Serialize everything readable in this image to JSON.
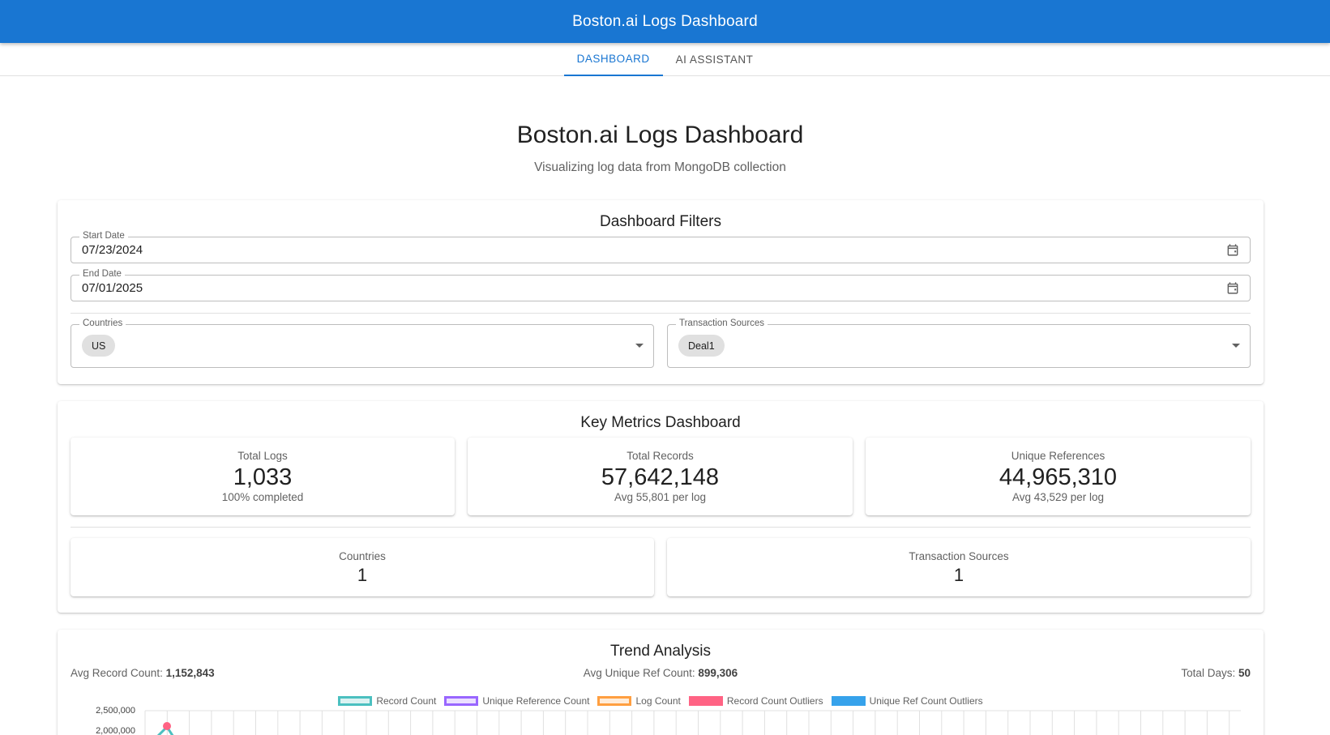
{
  "appbar": {
    "title": "Boston.ai Logs Dashboard"
  },
  "tabs": [
    {
      "label": "DASHBOARD",
      "active": true
    },
    {
      "label": "AI ASSISTANT",
      "active": false
    }
  ],
  "header": {
    "title": "Boston.ai Logs Dashboard",
    "subtitle": "Visualizing log data from MongoDB collection"
  },
  "filters": {
    "title": "Dashboard Filters",
    "start_date": {
      "label": "Start Date",
      "value": "07/23/2024"
    },
    "end_date": {
      "label": "End Date",
      "value": "07/01/2025"
    },
    "countries": {
      "label": "Countries",
      "chips": [
        "US"
      ]
    },
    "transaction_sources": {
      "label": "Transaction Sources",
      "chips": [
        "Deal1"
      ]
    }
  },
  "metrics": {
    "title": "Key Metrics Dashboard",
    "total_logs": {
      "label": "Total Logs",
      "value": "1,033",
      "sub": "100% completed"
    },
    "total_records": {
      "label": "Total Records",
      "value": "57,642,148",
      "sub": "Avg 55,801 per log"
    },
    "unique_refs": {
      "label": "Unique References",
      "value": "44,965,310",
      "sub": "Avg 43,529 per log"
    },
    "countries": {
      "label": "Countries",
      "value": "1"
    },
    "transaction_sources": {
      "label": "Transaction Sources",
      "value": "1"
    }
  },
  "trend": {
    "title": "Trend Analysis",
    "avg_record_label": "Avg Record Count:",
    "avg_record_value": "1,152,843",
    "avg_unique_label": "Avg Unique Ref Count:",
    "avg_unique_value": "899,306",
    "total_days_label": "Total Days:",
    "total_days_value": "50"
  },
  "chart_data": {
    "type": "line",
    "series": [
      {
        "name": "Record Count",
        "color": "#4bc0c0"
      },
      {
        "name": "Unique Reference Count",
        "color": "#9966ff"
      },
      {
        "name": "Log Count",
        "color": "#ff9f40"
      },
      {
        "name": "Record Count Outliers",
        "color": "#ff6384"
      },
      {
        "name": "Unique Ref Count Outliers",
        "color": "#36a2eb"
      }
    ],
    "y_ticks": [
      "2,500,000",
      "2,000,000"
    ],
    "grid": true,
    "legend_position": "top"
  }
}
